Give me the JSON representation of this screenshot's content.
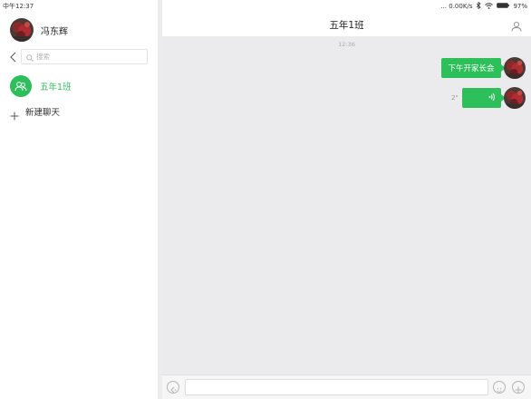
{
  "status": {
    "time": "中午12:37",
    "network": "... 0.00K/s",
    "battery": "97%"
  },
  "sidebar": {
    "user_name": "冯东辉",
    "search_placeholder": "搜索",
    "conversations": [
      {
        "label": "五年1班",
        "active": true
      }
    ],
    "new_chat_label": "新建聊天"
  },
  "chat": {
    "title": "五年1班",
    "timestamp": "12:36",
    "messages": [
      {
        "type": "text",
        "text": "下午开家长会",
        "from_self": true
      },
      {
        "type": "voice",
        "duration": "2\"",
        "from_self": true
      }
    ]
  },
  "colors": {
    "accent": "#2cbf5a",
    "chat_bg": "#ebebee"
  },
  "icons": {
    "back": "chevron-left-icon",
    "search": "search-icon",
    "group": "group-icon",
    "new_chat": "plus-icon",
    "members": "person-icon",
    "voice_mode": "voice-mode-icon",
    "emoji": "emoji-icon",
    "more": "plus-circle-icon"
  }
}
